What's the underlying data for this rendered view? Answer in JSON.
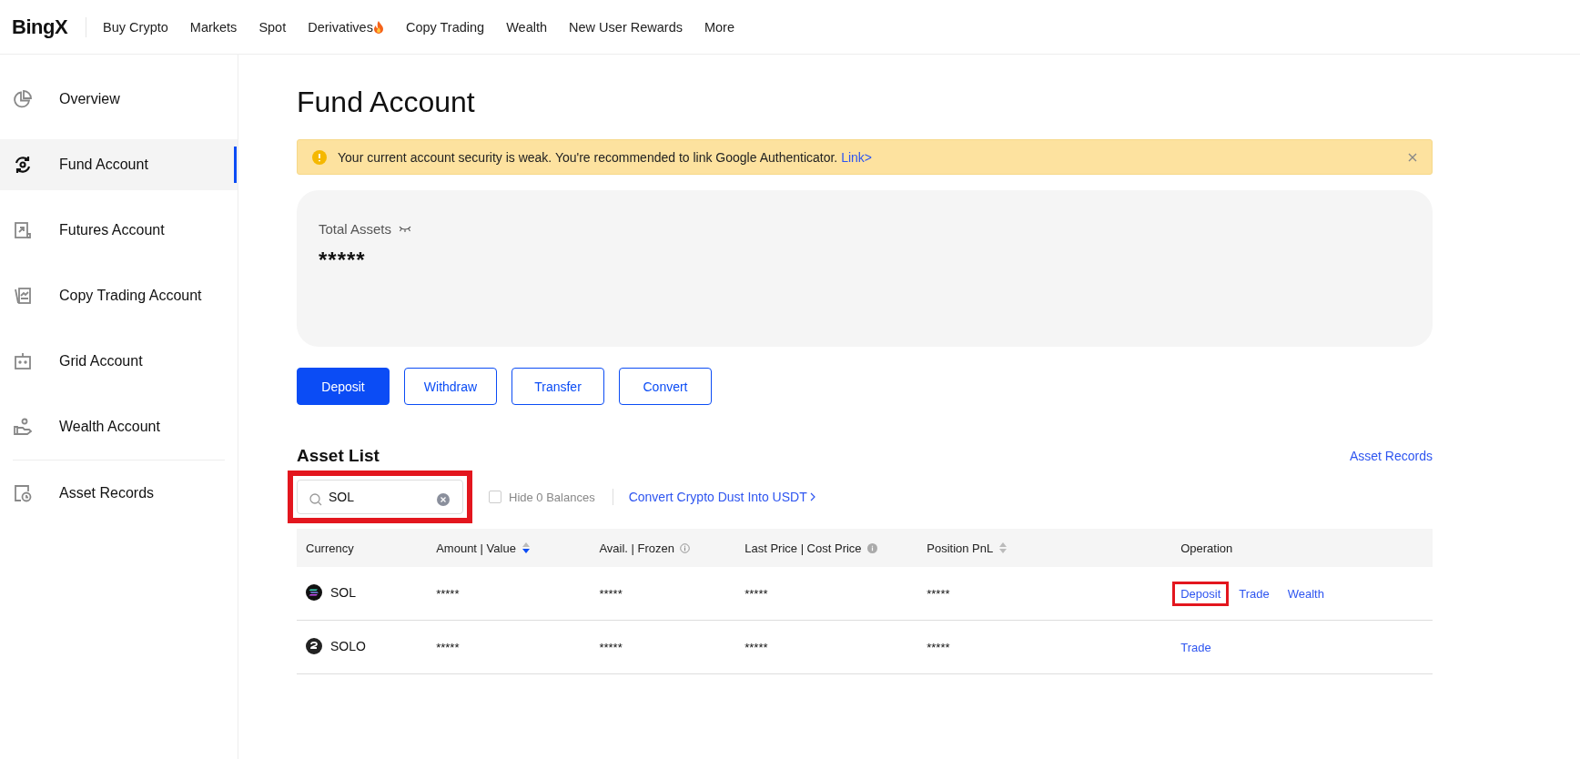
{
  "brand": {
    "logo": "BingX"
  },
  "nav": [
    {
      "label": "Buy Crypto",
      "hot": false
    },
    {
      "label": "Markets",
      "hot": false
    },
    {
      "label": "Spot",
      "hot": false
    },
    {
      "label": "Derivatives",
      "hot": true
    },
    {
      "label": "Copy Trading",
      "hot": false
    },
    {
      "label": "Wealth",
      "hot": false
    },
    {
      "label": "New User Rewards",
      "hot": false
    },
    {
      "label": "More",
      "hot": false
    }
  ],
  "sidebar": {
    "accounts": [
      {
        "label": "Overview",
        "kind": "pie",
        "selected": false
      },
      {
        "label": "Fund Account",
        "kind": "cycle",
        "selected": true
      },
      {
        "label": "Futures Account",
        "kind": "chart",
        "selected": false
      },
      {
        "label": "Copy Trading Account",
        "kind": "cards",
        "selected": false
      },
      {
        "label": "Grid Account",
        "kind": "robot",
        "selected": false
      },
      {
        "label": "Wealth Account",
        "kind": "hand",
        "selected": false
      }
    ],
    "records": [
      {
        "label": "Asset Records",
        "kind": "clock",
        "selected": false
      }
    ]
  },
  "page_title": "Fund Account",
  "alert": {
    "message": "Your current account security is weak. You're recommended to link Google Authenticator.",
    "link": "Link>"
  },
  "total_assets": {
    "label": "Total Assets",
    "value": "*****",
    "hidden": true
  },
  "actions": [
    {
      "label": "Deposit",
      "primary": true
    },
    {
      "label": "Withdraw",
      "primary": false
    },
    {
      "label": "Transfer",
      "primary": false
    },
    {
      "label": "Convert",
      "primary": false
    }
  ],
  "asset_list": {
    "title": "Asset List",
    "records_link": "Asset Records",
    "search": {
      "value": "SOL",
      "highlighted": true
    },
    "hide_zero": {
      "label": "Hide 0 Balances",
      "checked": false
    },
    "dust_link": "Convert Crypto Dust Into USDT",
    "table": {
      "columns": [
        {
          "label": "Currency",
          "kind": "plain"
        },
        {
          "label": "Amount | Value",
          "kind": "sorted"
        },
        {
          "label": "Avail. | Frozen",
          "kind": "info"
        },
        {
          "label": "Last Price | Cost Price",
          "kind": "infosolid"
        },
        {
          "label": "Position PnL",
          "kind": "sortable"
        },
        {
          "label": "Operation",
          "kind": "plain"
        }
      ],
      "rows": [
        {
          "currency": "SOL",
          "kind": "sol",
          "amount": "*****",
          "avail": "*****",
          "last_price": "*****",
          "pnl": "*****",
          "operations": [
            {
              "label": "Deposit",
              "highlighted": true
            },
            {
              "label": "Trade",
              "highlighted": false
            },
            {
              "label": "Wealth",
              "highlighted": false
            }
          ]
        },
        {
          "currency": "SOLO",
          "kind": "solo",
          "amount": "*****",
          "avail": "*****",
          "last_price": "*****",
          "pnl": "*****",
          "operations": [
            {
              "label": "Trade",
              "highlighted": false
            }
          ]
        }
      ]
    }
  }
}
